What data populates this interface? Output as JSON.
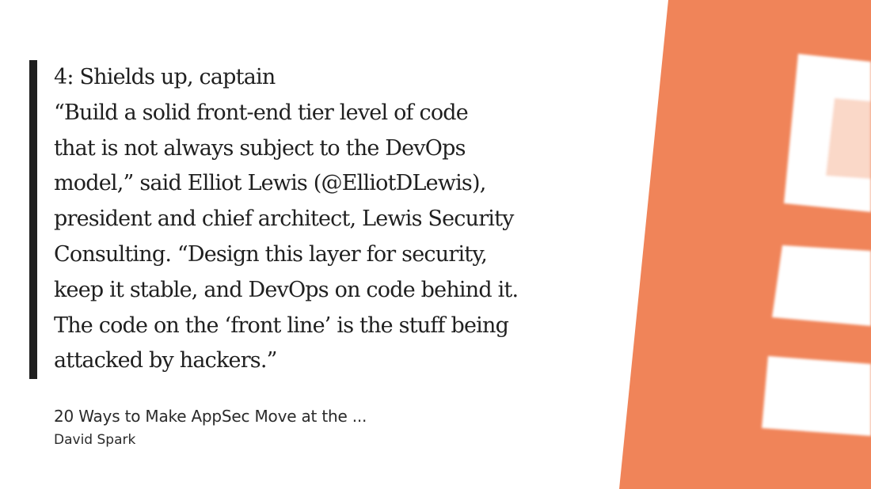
{
  "quote": {
    "lines": [
      "4: Shields up, captain",
      "“Build a solid front-end tier level of code",
      "that is not always subject to the DevOps",
      "model,” said Elliot Lewis (@ElliotDLewis),",
      "president and chief architect, Lewis Security",
      "Consulting. “Design this layer for security,",
      "keep it stable, and DevOps on code behind it.",
      "The code on the ‘front line’ is the stuff being",
      "attacked by hackers.”"
    ]
  },
  "source": {
    "title": "20 Ways to Make AppSec Move at the ...",
    "author": "David Spark"
  },
  "colors": {
    "accent_orange": "#f08459",
    "light_orange": "#fad8c8",
    "quote_bar": "#1f1f1f",
    "text": "#1f1f1f",
    "background": "#ffffff"
  },
  "icons": {
    "brand_logo": "stacked-bars-logo-icon"
  }
}
